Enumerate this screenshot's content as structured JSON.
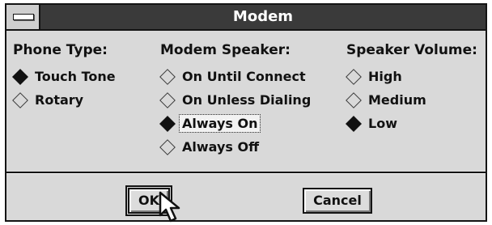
{
  "window": {
    "title": "Modem"
  },
  "groups": {
    "phone_type": {
      "heading": "Phone Type:",
      "options": [
        {
          "label": "Touch Tone",
          "selected": true
        },
        {
          "label": "Rotary",
          "selected": false
        }
      ]
    },
    "modem_speaker": {
      "heading": "Modem Speaker:",
      "options": [
        {
          "label": "On Until Connect",
          "selected": false
        },
        {
          "label": "On Unless Dialing",
          "selected": false
        },
        {
          "label": "Always On",
          "selected": true
        },
        {
          "label": "Always Off",
          "selected": false
        }
      ]
    },
    "speaker_volume": {
      "heading": "Speaker Volume:",
      "options": [
        {
          "label": "High",
          "selected": false
        },
        {
          "label": "Medium",
          "selected": false
        },
        {
          "label": "Low",
          "selected": true
        }
      ]
    }
  },
  "buttons": {
    "ok": "OK",
    "cancel": "Cancel"
  },
  "icons": {
    "system_menu": "system-menu-icon",
    "cursor": "mouse-pointer-icon"
  },
  "colors": {
    "title_bar": "#3a3a3a",
    "dialog_background": "#d9d9d9",
    "border": "#141414"
  }
}
